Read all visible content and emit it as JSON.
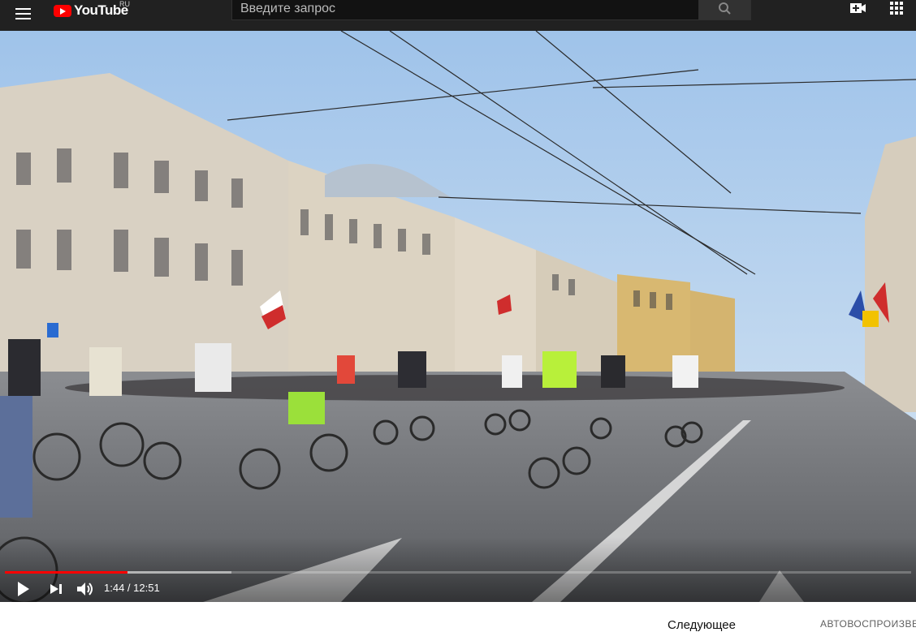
{
  "header": {
    "logo_text": "YouTube",
    "region": "RU",
    "search_placeholder": "Введите запрос",
    "icons": [
      "menu-icon",
      "search-icon",
      "create-video-icon",
      "apps-grid-icon"
    ],
    "brand_color": "#ff0000",
    "bar_color": "#212121"
  },
  "player": {
    "current_time": "1:44",
    "separator": " / ",
    "duration": "12:51",
    "played_fraction": 0.135,
    "buffered_fraction": 0.25,
    "controls": [
      "play-icon",
      "next-icon",
      "volume-icon"
    ],
    "progress_color": "#ff0000"
  },
  "below": {
    "next_label": "Следующее",
    "autoplay_label": "АВТОВОСПРОИЗВЕ"
  }
}
